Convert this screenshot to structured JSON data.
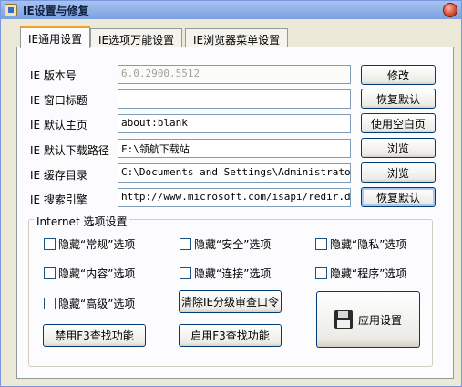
{
  "window": {
    "title": "IE设置与修复"
  },
  "tabs": [
    {
      "label": "IE通用设置"
    },
    {
      "label": "IE选项万能设置"
    },
    {
      "label": "IE浏览器菜单设置"
    }
  ],
  "rows": [
    {
      "label": "IE 版本号",
      "value": "6.0.2900.5512",
      "button": "修改"
    },
    {
      "label": "IE 窗口标题",
      "value": "",
      "button": "恢复默认"
    },
    {
      "label": "IE 默认主页",
      "value": "about:blank",
      "button": "使用空白页"
    },
    {
      "label": "IE 默认下载路径",
      "value": "F:\\领航下载站",
      "button": "浏览"
    },
    {
      "label": "IE 缓存目录",
      "value": "C:\\Documents and Settings\\Administrator\\Local Settings\\Temporary Internet Files",
      "button": "浏览"
    },
    {
      "label": "IE 搜索引擎",
      "value": "http://www.microsoft.com/isapi/redir.dll?prd=ie&ar=iesearch",
      "button": "恢复默认"
    }
  ],
  "options_group": {
    "title": "Internet 选项设置",
    "checkboxes": [
      "隐藏“常规”选项",
      "隐藏“安全”选项",
      "隐藏“隐私”选项",
      "隐藏“内容”选项",
      "隐藏“连接”选项",
      "隐藏“程序”选项",
      "隐藏“高级”选项"
    ],
    "clear_rating_button": "清除IE分级审查口令",
    "disable_f3_button": "禁用F3查找功能",
    "enable_f3_button": "启用F3查找功能",
    "apply_button": "应用设置"
  }
}
